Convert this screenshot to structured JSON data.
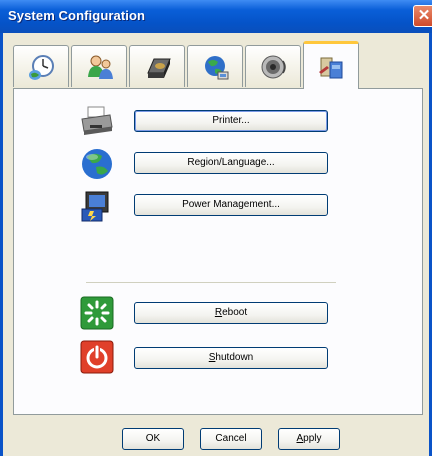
{
  "window": {
    "title": "System Configuration"
  },
  "tabs": [
    {
      "icon": "clock-globe-icon",
      "active": false
    },
    {
      "icon": "people-network-icon",
      "active": false
    },
    {
      "icon": "hard-disk-icon",
      "active": false
    },
    {
      "icon": "network-globe-icon",
      "active": false
    },
    {
      "icon": "speaker-icon",
      "active": false
    },
    {
      "icon": "tools-icon",
      "active": true
    }
  ],
  "actions": {
    "printer": {
      "label": "Printer...",
      "icon": "printer-icon"
    },
    "region": {
      "label": "Region/Language...",
      "icon": "globe-icon"
    },
    "power": {
      "label": "Power Management...",
      "icon": "power-management-icon"
    },
    "reboot": {
      "label_first": "R",
      "label_rest": "eboot",
      "icon": "reboot-icon"
    },
    "shutdown": {
      "label_first": "S",
      "label_rest": "hutdown",
      "icon": "shutdown-icon"
    }
  },
  "footer": {
    "ok": "OK",
    "cancel": "Cancel",
    "apply_first": "A",
    "apply_rest": "pply"
  },
  "colors": {
    "titlebar": "#0553c8",
    "dialog_bg": "#ece9d8",
    "panel_bg": "#fcfcfe",
    "active_tab_accent": "#ffc73c"
  }
}
